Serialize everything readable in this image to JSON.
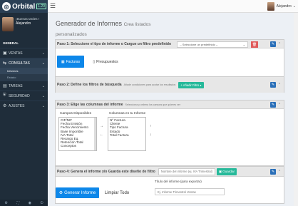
{
  "app": {
    "brand": "Orbital",
    "version": "1.20"
  },
  "user": {
    "greeting": "¡Buenas tardes !",
    "name": "Alejandro",
    "menu_name": "Alejandro"
  },
  "sidebar": {
    "section": "GENERAL",
    "items": [
      {
        "icon": "▣",
        "label": "VENTAS",
        "chev": "⌄"
      },
      {
        "icon": "⇆",
        "label": "CONSULTAS",
        "chev": "⌄"
      },
      {
        "icon": "▤",
        "label": "TAREAS",
        "chev": "⌄"
      },
      {
        "icon": "⛨",
        "label": "SEGURIDAD",
        "chev": "⌄"
      },
      {
        "icon": "⚙",
        "label": "AJUSTES",
        "chev": "⌄"
      }
    ],
    "subitems": [
      "Informes",
      "Estado"
    ],
    "bottom_icons": [
      "⚙",
      "⛶",
      "◉",
      "⏻"
    ]
  },
  "page": {
    "title": "Generador de Informes",
    "subtitle": "Crea listados personalizados"
  },
  "step1": {
    "title": "Paso 1: Seleccione el tipo de informe o Cargue un filtro predefinido",
    "select": "-- Seleccione un predefinido --",
    "tab_facturas": "Facturas",
    "tab_presupuestos": "Presupuestos"
  },
  "step2": {
    "title": "Paso 2: Define los filtros de búsqueda",
    "hint": "Añade condiciones para acotar los resultados",
    "add": "+ Añadir Filtro ▾"
  },
  "step3": {
    "title": "Paso 3: Elige las columnas del informe",
    "hint": "Selecciona y ordena los campos que quieres ver",
    "available_label": "Campos Disponibles",
    "available": [
      "CIF/NIF",
      "Fecha Emisión",
      "Fecha Vencimiento",
      "Base Imponible",
      "IVA Total",
      "Recargo Eq.",
      "Retención Total",
      "Conceptos"
    ],
    "columns_label": "Columnas en tu Informe",
    "columns": [
      "Nº Factura",
      "Cliente",
      "Tipo Factura",
      "Estado",
      "Total Factura"
    ],
    "arrows": [
      "→",
      "←",
      "↑",
      "↓"
    ]
  },
  "step4": {
    "title": "Paso 4: Genera el informe y/o Guarda este diseño de filtro",
    "name_placeholder": "Nombre del informe (ej. IVA Trimestral)",
    "save": "Guardar",
    "export_label": "Título del informe (para exportar)",
    "export_placeholder": "Ej. Informe Trimestral Ventas",
    "generate": "Generar Informe",
    "clear": "Limpiar Todo"
  },
  "colors": {
    "sidebar": "#1f2d3a",
    "brand": "#2a3f54",
    "primary": "#0d87e9",
    "success": "#26b99a",
    "danger": "#e05a5a",
    "edit": "#2a6fb8"
  }
}
